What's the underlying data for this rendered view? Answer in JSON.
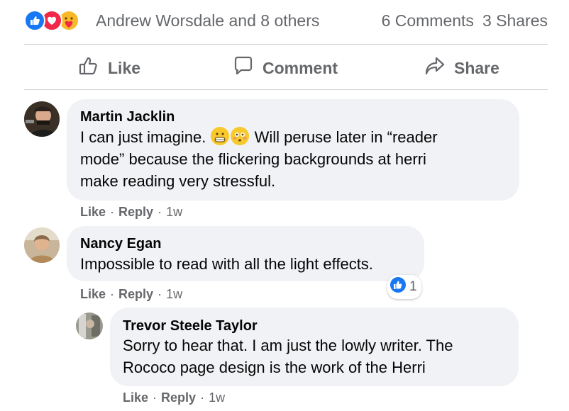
{
  "post_summary": {
    "reacted_by": "Andrew Worsdale and 8 others",
    "comments_count": "6 Comments",
    "shares_count": "3 Shares",
    "reaction_icons": [
      "like-icon",
      "love-icon",
      "care-icon"
    ]
  },
  "actions": {
    "like": "Like",
    "comment": "Comment",
    "share": "Share"
  },
  "colors": {
    "like_blue": "#1877f2",
    "love_red": "#f02849",
    "bubble_bg": "#f0f2f5",
    "secondary_text": "#65676b"
  },
  "comments": [
    {
      "author": "Martin Jacklin",
      "text_part1": "I can just imagine.",
      "emojis": [
        "grimacing-face-emoji",
        "flushed-face-emoji"
      ],
      "text_line1_rest": "Will peruse later in “reader",
      "text_line2": "mode” because the flickering backgrounds at herri",
      "text_line3": "make reading very stressful.",
      "like": "Like",
      "reply": "Reply",
      "time": "1w"
    },
    {
      "author": "Nancy Egan",
      "text": "Impossible to read with all the light effects.",
      "reaction_count": "1",
      "like": "Like",
      "reply": "Reply",
      "time": "1w"
    },
    {
      "author": "Trevor Steele Taylor",
      "text_line1": "Sorry to hear that. I am just the lowly writer. The",
      "text_line2": "Rococo page design is the work of the Herri",
      "like": "Like",
      "reply": "Reply",
      "time": "1w"
    }
  ]
}
